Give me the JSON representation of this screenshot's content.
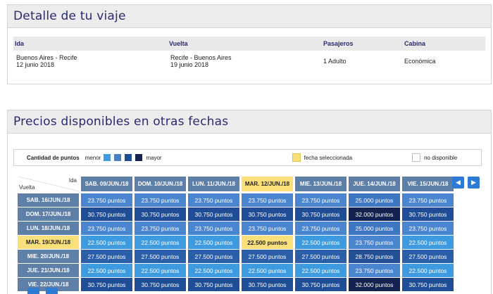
{
  "trip": {
    "title": "Detalle de tu viaje",
    "headers": [
      "Ida",
      "Vuelta",
      "Pasajeros",
      "Cabina"
    ],
    "ida_route": "Buenos Aires - Recife",
    "ida_date": "12 junio 2018",
    "vuelta_route": "Recife - Buenos Aires",
    "vuelta_date": "19 junio 2018",
    "pasajeros": "1 Adulto",
    "cabina": "Económica"
  },
  "prices": {
    "title": "Precios disponibles en otras fechas",
    "legend": {
      "label": "Cantidad de puntos",
      "menor": "menor",
      "mayor": "mayor",
      "selected": "fecha seleccionada",
      "unavailable": "no disponible",
      "scale_colors": [
        "#3f9be0",
        "#4d7fc4",
        "#1f4e96",
        "#15244f"
      ],
      "selected_color": "#f9e07a"
    },
    "corner_ida": "Ida",
    "corner_vuelta": "Vuelta",
    "columns": [
      "SAB. 09/JUN./18",
      "DOM. 10/JUN./18",
      "LUN. 11/JUN./18",
      "MAR. 12/JUN./18",
      "MIE. 13/JUN./18",
      "JUE. 14/JUN./18",
      "VIE. 15/JUN./18"
    ],
    "rows": [
      {
        "label": "SAB. 16/JUN./18",
        "cells": [
          "23.750 puntos",
          "23.750 puntos",
          "23.750 puntos",
          "23.750 puntos",
          "23.750 puntos",
          "25.000 puntos",
          "23.750 puntos"
        ],
        "colors": [
          "#4a86cf",
          "#4a86cf",
          "#4a86cf",
          "#4a86cf",
          "#4a86cf",
          "#3d77c2",
          "#4a86cf"
        ]
      },
      {
        "label": "DOM. 17/JUN./18",
        "cells": [
          "30.750 puntos",
          "30.750 puntos",
          "30.750 puntos",
          "30.750 puntos",
          "30.750 puntos",
          "32.000 puntos",
          "30.750 puntos"
        ],
        "colors": [
          "#1f4e96",
          "#1f4e96",
          "#1f4e96",
          "#1f4e96",
          "#1f4e96",
          "#14224f",
          "#1f4e96"
        ]
      },
      {
        "label": "LUN. 18/JUN./18",
        "cells": [
          "23.750 puntos",
          "23.750 puntos",
          "23.750 puntos",
          "23.750 puntos",
          "23.750 puntos",
          "25.000 puntos",
          "23.750 puntos"
        ],
        "colors": [
          "#4a86cf",
          "#4a86cf",
          "#4a86cf",
          "#4a86cf",
          "#4a86cf",
          "#3d77c2",
          "#4a86cf"
        ]
      },
      {
        "label": "MAR. 19/JUN./18",
        "cells": [
          "22.500 puntos",
          "22.500 puntos",
          "22.500 puntos",
          "22.500 puntos",
          "22.500 puntos",
          "23.750 puntos",
          "22.500 puntos"
        ],
        "colors": [
          "#3f9be0",
          "#3f9be0",
          "#3f9be0",
          "#f9e07a",
          "#3f9be0",
          "#4a86cf",
          "#3f9be0"
        ],
        "selected": true
      },
      {
        "label": "MIE. 20/JUN./18",
        "cells": [
          "27.500 puntos",
          "27.500 puntos",
          "27.500 puntos",
          "27.500 puntos",
          "27.500 puntos",
          "28.750 puntos",
          "27.500 puntos"
        ],
        "colors": [
          "#2a5ea8",
          "#2a5ea8",
          "#2a5ea8",
          "#2a5ea8",
          "#2a5ea8",
          "#234f94",
          "#2a5ea8"
        ]
      },
      {
        "label": "JUE. 21/JUN./18",
        "cells": [
          "22.500 puntos",
          "22.500 puntos",
          "22.500 puntos",
          "22.500 puntos",
          "22.500 puntos",
          "23.750 puntos",
          "22.500 puntos"
        ],
        "colors": [
          "#3f9be0",
          "#3f9be0",
          "#3f9be0",
          "#3f9be0",
          "#3f9be0",
          "#4a86cf",
          "#3f9be0"
        ]
      },
      {
        "label": "VIE. 22/JUN./18",
        "cells": [
          "30.750 puntos",
          "30.750 puntos",
          "30.750 puntos",
          "30.750 puntos",
          "30.750 puntos",
          "32.000 puntos",
          "30.750 puntos"
        ],
        "colors": [
          "#1f4e96",
          "#1f4e96",
          "#1f4e96",
          "#1f4e96",
          "#1f4e96",
          "#14224f",
          "#1f4e96"
        ]
      }
    ],
    "selected_column": 3,
    "selected_row": 3,
    "nav_prev_icon": "◀",
    "nav_next_icon": "▶"
  }
}
